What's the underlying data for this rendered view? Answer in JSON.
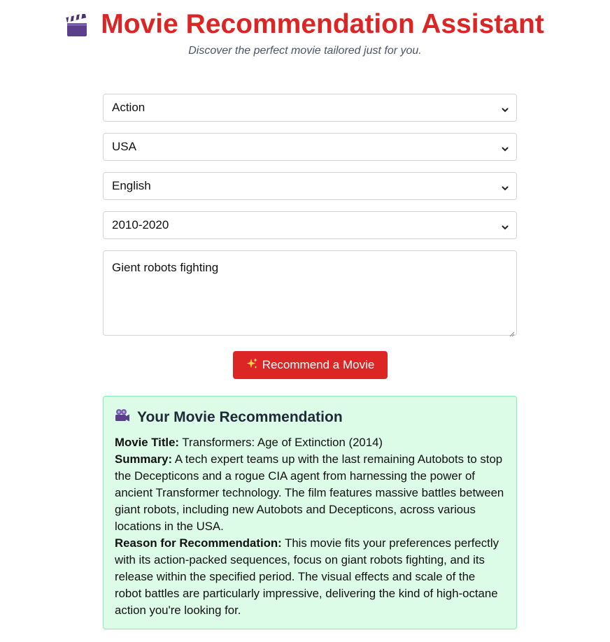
{
  "header": {
    "icon": "clapperboard-icon",
    "title": "Movie Recommendation Assistant",
    "subtitle": "Discover the perfect movie tailored just for you."
  },
  "form": {
    "genre": "Action",
    "country": "USA",
    "language": "English",
    "period": "2010-2020",
    "description": "Gient robots fighting"
  },
  "button": {
    "icon": "sparkles-icon",
    "label": "Recommend a Movie"
  },
  "recommendation": {
    "icon": "movie-camera-icon",
    "heading": "Your Movie Recommendation",
    "title_label": "Movie Title:",
    "title_value": "Transformers: Age of Extinction (2014)",
    "summary_label": "Summary:",
    "summary_value": "A tech expert teams up with the last remaining Autobots to stop the Decepticons and a rogue CIA agent from harnessing the power of ancient Transformer technology. The film features massive battles between giant robots, including new Autobots and Decepticons, across various locations in the USA.",
    "reason_label": "Reason for Recommendation:",
    "reason_value": "This movie fits your preferences perfectly with its action-packed sequences, focus on giant robots fighting, and its release within the specified period. The visual effects and scale of the robot battles are particularly impressive, delivering the kind of high-octane action you're looking for."
  },
  "colors": {
    "accent": "#dc2626",
    "result_bg": "#dcfce7",
    "result_border": "#86efac"
  }
}
